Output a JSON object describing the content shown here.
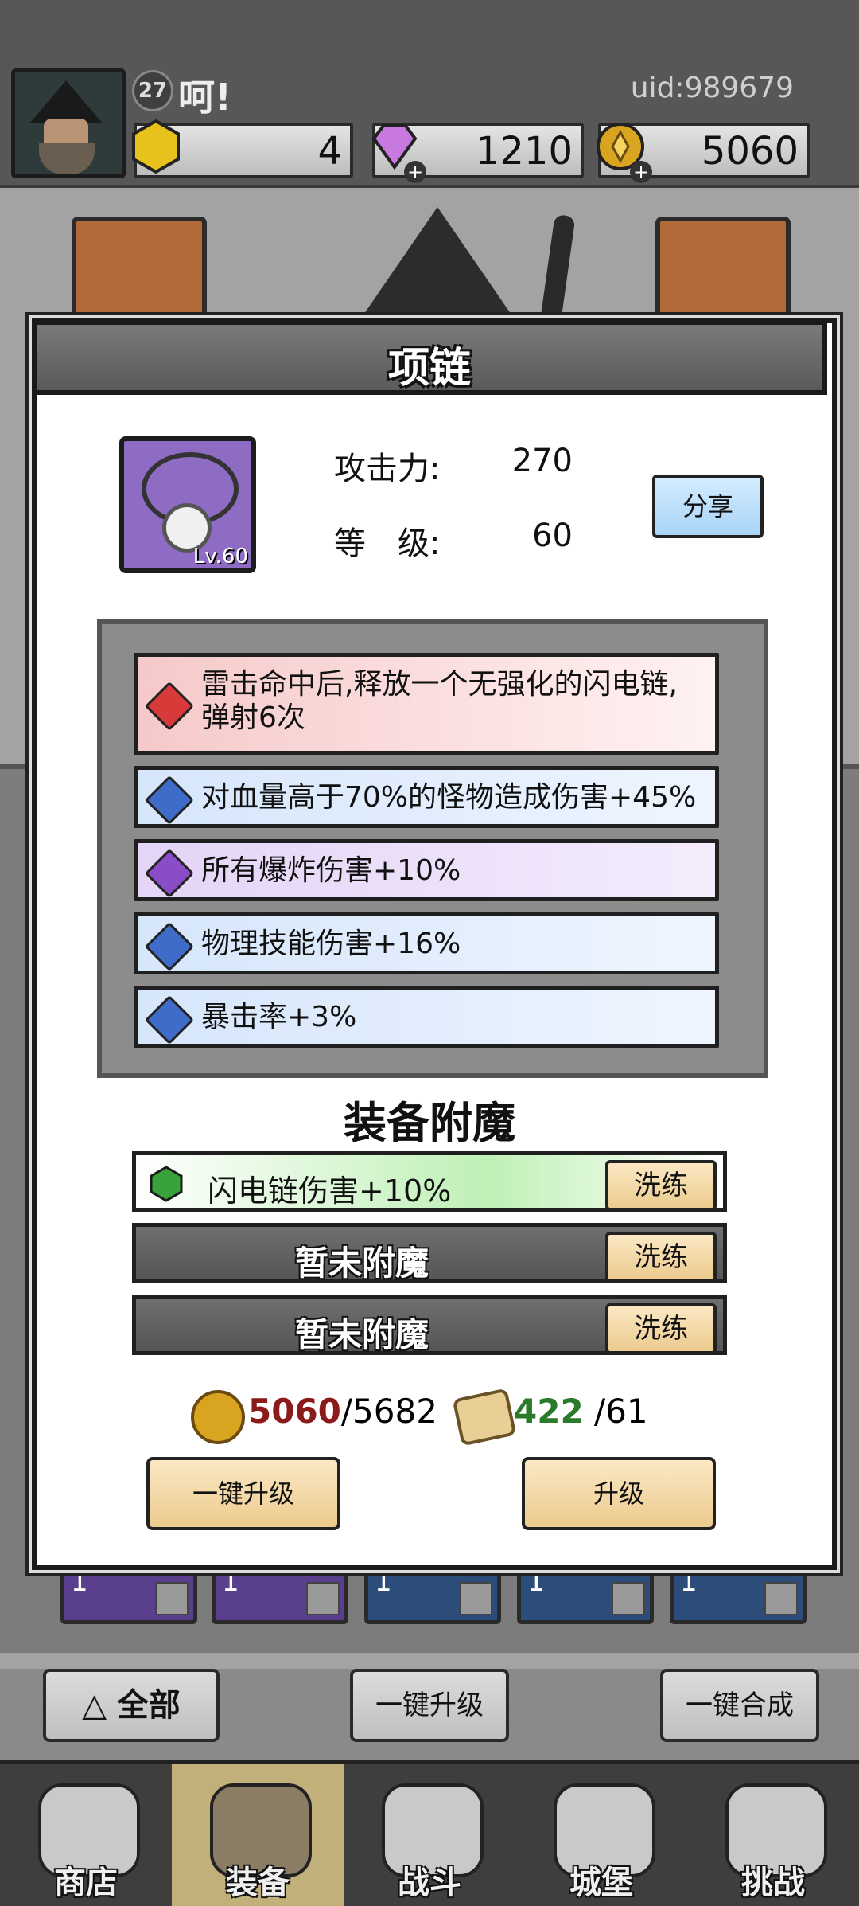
{
  "player": {
    "level": "27",
    "name": "呵!",
    "uid": "uid:989679"
  },
  "resources": {
    "energy": "4",
    "gems": "1210",
    "gold": "5060",
    "plus": "+"
  },
  "modal": {
    "title": "项链",
    "item": {
      "level": "Lv.60",
      "attack_label": "攻击力:",
      "attack_value": "270",
      "level_label": "等　级:",
      "level_value": "60",
      "share": "分享"
    },
    "affixes": [
      {
        "text": "雷击命中后,释放一个无强化的闪电链,弹射6次",
        "color": "red"
      },
      {
        "text": "对血量高于70%的怪物造成伤害+45%",
        "color": "blue"
      },
      {
        "text": "所有爆炸伤害+10%",
        "color": "purple"
      },
      {
        "text": "物理技能伤害+16%",
        "color": "blue"
      },
      {
        "text": "暴击率+3%",
        "color": "blue"
      }
    ],
    "enchant": {
      "title": "装备附魔",
      "slots": [
        {
          "text": "闪电链伤害+10%",
          "button": "洗练"
        },
        {
          "text": "暂未附魔",
          "button": "洗练"
        },
        {
          "text": "暂未附魔",
          "button": "洗练"
        }
      ]
    },
    "costs": {
      "gold_have": "5060",
      "gold_need": "/5682",
      "scroll_have": "422",
      "scroll_need": " /61"
    },
    "buttons": {
      "upgrade_all": "一键升级",
      "upgrade": "升级"
    }
  },
  "inventory_counts": [
    "1",
    "1",
    "1",
    "1",
    "1"
  ],
  "actions": {
    "filter": "全部",
    "upgrade_all": "一键升级",
    "merge_all": "一键合成"
  },
  "nav": [
    {
      "label": "商店"
    },
    {
      "label": "装备"
    },
    {
      "label": "战斗"
    },
    {
      "label": "城堡"
    },
    {
      "label": "挑战"
    }
  ],
  "colors": {
    "affix_red": "#f6c9c9",
    "affix_blue": "#d6e6fb",
    "affix_purple": "#e4d4f6",
    "enchant_green": "#bff0b6"
  }
}
